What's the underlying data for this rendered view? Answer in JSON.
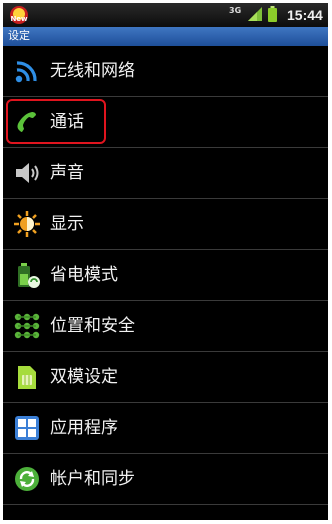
{
  "status_bar": {
    "network": "3G",
    "time": "15:44",
    "news_badge": "New"
  },
  "title_bar": {
    "title": "设定"
  },
  "settings_items": [
    {
      "label": "无线和网络",
      "icon": "wifi-icon",
      "color": "#2f8fe6"
    },
    {
      "label": "通话",
      "icon": "phone-icon",
      "color": "#5bc23a"
    },
    {
      "label": "声音",
      "icon": "speaker-icon",
      "color": "#c8c8c8"
    },
    {
      "label": "显示",
      "icon": "brightness-icon",
      "color": "#f0a020"
    },
    {
      "label": "省电模式",
      "icon": "battery-saver-icon",
      "color": "#4caf3a"
    },
    {
      "label": "位置和安全",
      "icon": "location-grid-icon",
      "color": "#5ab33a"
    },
    {
      "label": "双模设定",
      "icon": "sim-card-icon",
      "color": "#8fd13a"
    },
    {
      "label": "应用程序",
      "icon": "apps-icon",
      "color": "#3b7fd6"
    },
    {
      "label": "帐户和同步",
      "icon": "sync-icon",
      "color": "#4caf3a"
    }
  ],
  "highlight_color": "#e0141e"
}
